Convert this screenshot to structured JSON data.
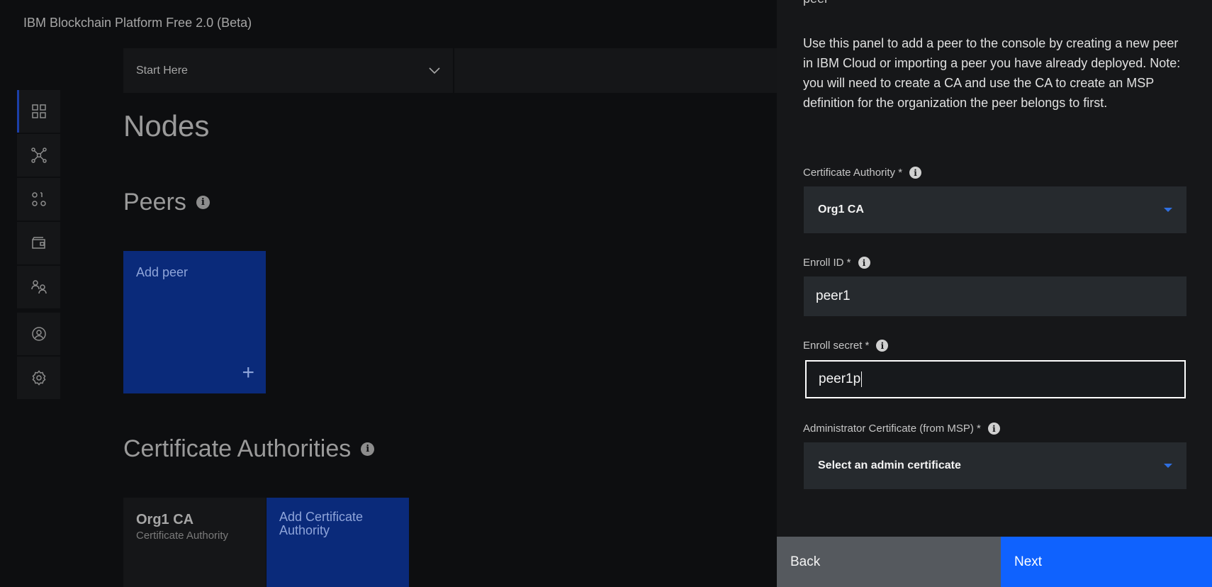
{
  "app": {
    "title": "IBM Blockchain Platform Free 2.0 (Beta)"
  },
  "sidebar": {
    "items": [
      {
        "name": "nodes",
        "icon": "dashboard-grid-icon",
        "active": true
      },
      {
        "name": "channels",
        "icon": "network-icon",
        "active": false
      },
      {
        "name": "smart-contracts",
        "icon": "binary-code-icon",
        "active": false
      },
      {
        "name": "wallet",
        "icon": "wallet-icon",
        "active": false
      },
      {
        "name": "organizations",
        "icon": "users-icon",
        "active": false
      },
      {
        "name": "account",
        "icon": "user-avatar-icon",
        "active": false
      },
      {
        "name": "settings",
        "icon": "gear-icon",
        "active": false
      }
    ]
  },
  "start_here": {
    "label": "Start Here"
  },
  "main": {
    "page_title": "Nodes",
    "peers": {
      "heading": "Peers",
      "add_tile_label": "Add peer"
    },
    "cas": {
      "heading": "Certificate Authorities",
      "tiles": [
        {
          "name": "Org1 CA",
          "subtitle": "Certificate Authority"
        }
      ],
      "add_tile_label": "Add Certificate Authority"
    }
  },
  "panel": {
    "cut_heading": "peer",
    "description": "Use this panel to add a peer to the console by creating a new peer in IBM Cloud or importing a peer you have already deployed. Note: you will need to create a CA and use the CA to create an MSP definition for the organization the peer belongs to first.",
    "fields": {
      "ca": {
        "label": "Certificate Authority *",
        "value": "Org1 CA"
      },
      "enroll_id": {
        "label": "Enroll ID *",
        "value": "peer1"
      },
      "enroll_secret": {
        "label": "Enroll secret *",
        "value": "peer1p"
      },
      "admin_cert": {
        "label": "Administrator Certificate (from MSP) *",
        "value": "Select an admin certificate"
      }
    },
    "buttons": {
      "back": "Back",
      "next": "Next"
    }
  },
  "colors": {
    "primary": "#0f62fe",
    "secondary": "#55595e",
    "panel_bg": "#161719"
  }
}
